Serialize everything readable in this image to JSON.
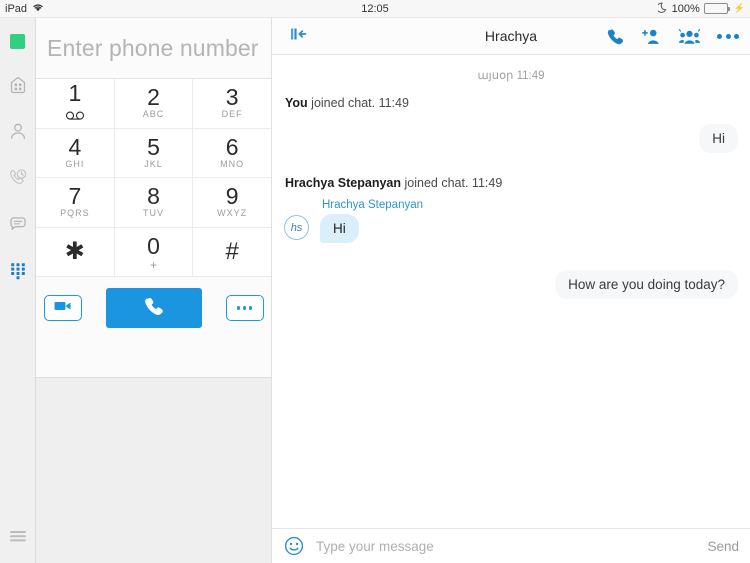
{
  "status_bar": {
    "device": "iPad",
    "wifi_icon": "wifi-icon",
    "time": "12:05",
    "dnd_icon": "moon-icon",
    "battery_percent": "100%",
    "battery_icon": "battery-icon",
    "charging_icon": "bolt-icon",
    "battery_color": "#4cd964"
  },
  "rail": {
    "items": [
      {
        "name": "status-indicator",
        "icon": "green-square-icon"
      },
      {
        "name": "rail-item-home",
        "icon": "home-icon"
      },
      {
        "name": "rail-item-contacts",
        "icon": "person-icon"
      },
      {
        "name": "rail-item-recents",
        "icon": "phone-clock-icon"
      },
      {
        "name": "rail-item-chats",
        "icon": "chat-bubble-icon"
      },
      {
        "name": "rail-item-dialpad",
        "icon": "dialpad-icon",
        "active": true
      }
    ],
    "menu_icon": "hamburger-menu-icon",
    "active_color": "#1b7fc0"
  },
  "dialer": {
    "phone_input_placeholder": "Enter phone number",
    "phone_input_value": "",
    "keys": [
      {
        "digit": "1",
        "sub": "",
        "icon": "voicemail-icon"
      },
      {
        "digit": "2",
        "sub": "ABC"
      },
      {
        "digit": "3",
        "sub": "DEF"
      },
      {
        "digit": "4",
        "sub": "GHI"
      },
      {
        "digit": "5",
        "sub": "JKL"
      },
      {
        "digit": "6",
        "sub": "MNO"
      },
      {
        "digit": "7",
        "sub": "PQRS"
      },
      {
        "digit": "8",
        "sub": "TUV"
      },
      {
        "digit": "9",
        "sub": "WXYZ"
      },
      {
        "digit": "✱",
        "sub": ""
      },
      {
        "digit": "0",
        "sub": "+"
      },
      {
        "digit": "#",
        "sub": ""
      }
    ],
    "actions": {
      "video_icon": "video-camera-icon",
      "call_icon": "phone-handset-icon",
      "more_icon": "ellipsis-icon",
      "call_button_color": "#1b95e0"
    }
  },
  "chat": {
    "collapse_icon": "collapse-panel-icon",
    "title": "Hrachya",
    "header_actions": [
      {
        "name": "call-button",
        "icon": "phone-icon"
      },
      {
        "name": "add-person-button",
        "icon": "person-plus-icon"
      },
      {
        "name": "group-button",
        "icon": "people-group-icon"
      },
      {
        "name": "more-options-button",
        "icon": "ellipsis-icon"
      }
    ],
    "accent_color": "#1b82c8",
    "day_separator": "այսօր 11:49",
    "events": [
      {
        "actor": "You",
        "text": "joined chat. 11:49"
      },
      {
        "actor": "Hrachya Stepanyan",
        "text": "joined chat. 11:49"
      }
    ],
    "messages": [
      {
        "direction": "out",
        "text": "Hi"
      },
      {
        "direction": "in",
        "sender": "Hrachya Stepanyan",
        "avatar": "hs",
        "text": "Hi"
      },
      {
        "direction": "out",
        "text": "How are you doing today?"
      }
    ],
    "composer": {
      "emoji_icon": "emoji-smiley-icon",
      "placeholder": "Type your message",
      "value": "",
      "send_label": "Send"
    }
  }
}
